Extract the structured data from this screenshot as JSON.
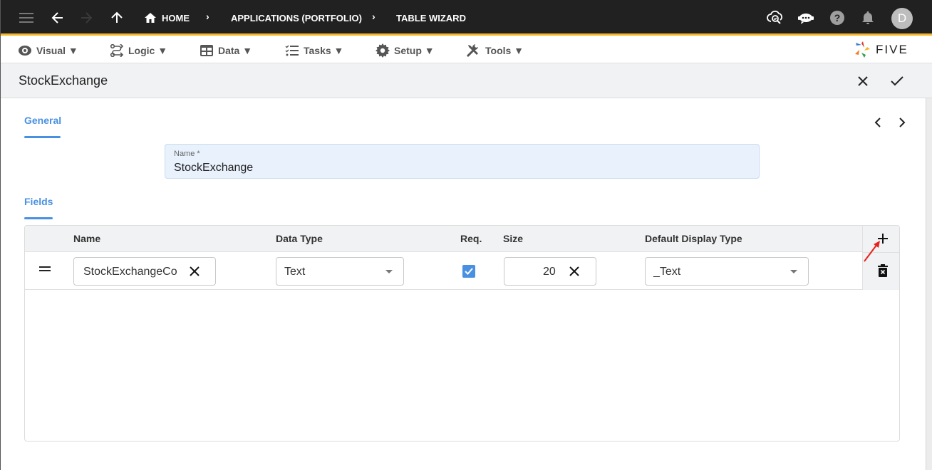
{
  "appbar": {
    "breadcrumbs": [
      "HOME",
      "APPLICATIONS (PORTFOLIO)",
      "TABLE WIZARD"
    ],
    "avatar_initial": "D",
    "accent_color": "#f7b529",
    "icons": [
      "menu-icon",
      "back-arrow-icon",
      "forward-arrow-icon",
      "up-arrow-icon",
      "home-icon",
      "cloud-search-icon",
      "chatbot-icon",
      "help-icon",
      "notification-bell-icon"
    ]
  },
  "menubar": {
    "items": [
      {
        "label": "Visual ▼",
        "icon": "eye-icon"
      },
      {
        "label": "Logic ▼",
        "icon": "logic-flow-icon"
      },
      {
        "label": "Data ▼",
        "icon": "table-grid-icon"
      },
      {
        "label": "Tasks ▼",
        "icon": "checklist-icon"
      },
      {
        "label": "Setup ▼",
        "icon": "gear-icon"
      },
      {
        "label": "Tools ▼",
        "icon": "tools-icon"
      }
    ],
    "logo_text": "FIVE"
  },
  "titlebar": {
    "title": "StockExchange"
  },
  "form": {
    "general_tab": "General",
    "name_label": "Name *",
    "name_value": "StockExchange",
    "fields_tab": "Fields"
  },
  "fields_table": {
    "columns": [
      "Name",
      "Data Type",
      "Req.",
      "Size",
      "Default Display Type"
    ],
    "rows": [
      {
        "name": "StockExchangeCo",
        "data_type": "Text",
        "required": true,
        "size": "20",
        "default_display_type": "_Text"
      }
    ]
  },
  "colors": {
    "accent_blue": "#4a90e2",
    "name_field_bg": "#e8f1fc",
    "annotation_red": "#e8211c"
  }
}
